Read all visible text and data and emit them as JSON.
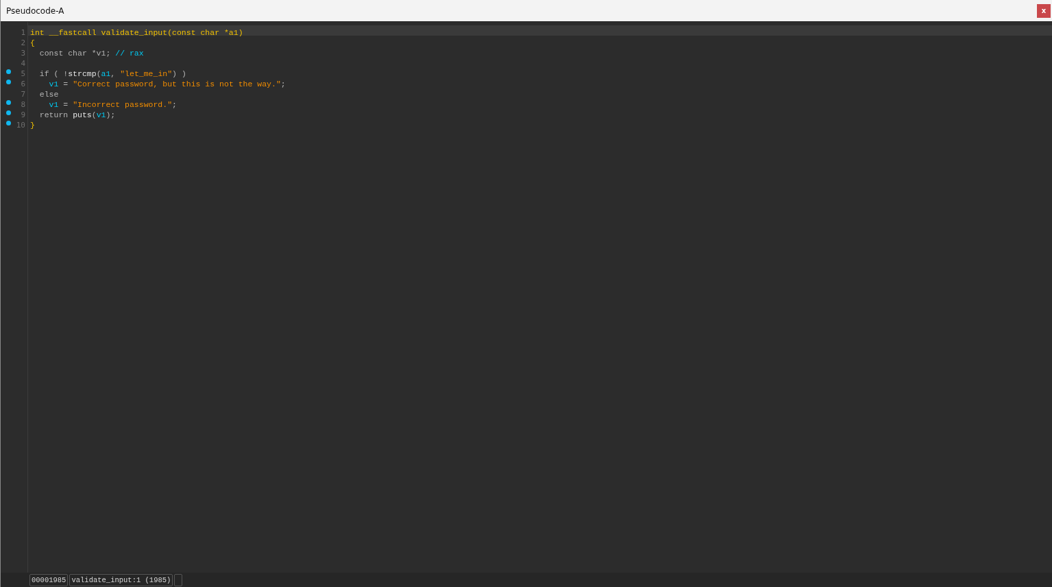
{
  "window": {
    "title": "Pseudocode-A",
    "close_label": "x"
  },
  "code_lines": [
    {
      "number": "1",
      "marked": false,
      "current": true,
      "tokens": [
        {
          "text": "int __fastcall validate_input(const char *a1)",
          "kind": "decl"
        }
      ]
    },
    {
      "number": "2",
      "marked": false,
      "current": false,
      "tokens": [
        {
          "text": "{",
          "kind": "decl"
        }
      ]
    },
    {
      "number": "3",
      "marked": false,
      "current": false,
      "tokens": [
        {
          "text": "  const char *v1; ",
          "kind": "plain"
        },
        {
          "text": "// rax",
          "kind": "comment"
        }
      ]
    },
    {
      "number": "4",
      "marked": false,
      "current": false
    },
    {
      "number": "5",
      "marked": true,
      "current": false,
      "tokens": [
        {
          "text": "  if ( !",
          "kind": "plain"
        },
        {
          "text": "strcmp",
          "kind": "func"
        },
        {
          "text": "(",
          "kind": "plain"
        },
        {
          "text": "a1",
          "kind": "var"
        },
        {
          "text": ", ",
          "kind": "plain"
        },
        {
          "text": "\"let_me_in\"",
          "kind": "str"
        },
        {
          "text": ") )",
          "kind": "plain"
        }
      ]
    },
    {
      "number": "6",
      "marked": true,
      "current": false,
      "tokens": [
        {
          "text": "    v1",
          "kind": "var"
        },
        {
          "text": " = ",
          "kind": "plain"
        },
        {
          "text": "\"Correct password, but this is not the way.\"",
          "kind": "str"
        },
        {
          "text": ";",
          "kind": "plain"
        }
      ]
    },
    {
      "number": "7",
      "marked": false,
      "current": false,
      "tokens": [
        {
          "text": "  else",
          "kind": "plain"
        }
      ]
    },
    {
      "number": "8",
      "marked": true,
      "current": false,
      "tokens": [
        {
          "text": "    v1",
          "kind": "var"
        },
        {
          "text": " = ",
          "kind": "plain"
        },
        {
          "text": "\"Incorrect password.\"",
          "kind": "str"
        },
        {
          "text": ";",
          "kind": "plain"
        }
      ]
    },
    {
      "number": "9",
      "marked": true,
      "current": false,
      "tokens": [
        {
          "text": "  return ",
          "kind": "plain"
        },
        {
          "text": "puts",
          "kind": "func"
        },
        {
          "text": "(",
          "kind": "plain"
        },
        {
          "text": "v1",
          "kind": "var"
        },
        {
          "text": ");",
          "kind": "plain"
        }
      ]
    },
    {
      "number": "10",
      "marked": true,
      "current": false,
      "tokens": [
        {
          "text": "}",
          "kind": "decl"
        }
      ]
    }
  ],
  "status_bar": {
    "address": "00001985",
    "location": "validate_input:1 (1985)"
  }
}
